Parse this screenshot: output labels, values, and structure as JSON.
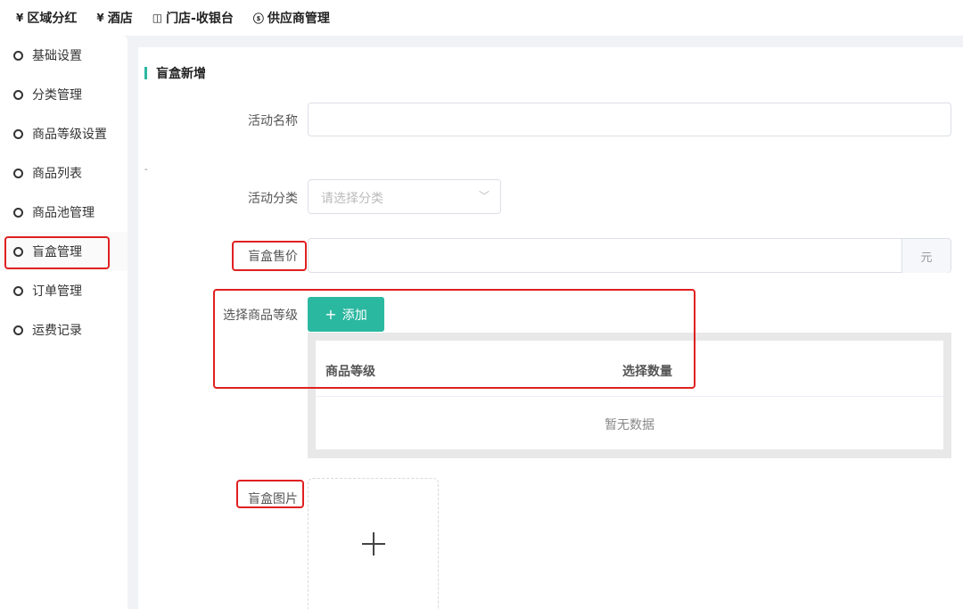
{
  "topnav": [
    {
      "icon": "¥",
      "icon_name": "dividend-icon",
      "label": "区域分红"
    },
    {
      "icon": "¥",
      "icon_name": "yen-icon",
      "label": "酒店"
    },
    {
      "icon": "◫",
      "icon_name": "cashier-icon",
      "label": "门店-收银台"
    },
    {
      "icon": "ⓢ",
      "icon_name": "supplier-icon",
      "label": "供应商管理"
    }
  ],
  "sidebar": {
    "items": [
      {
        "label": "基础设置"
      },
      {
        "label": "分类管理"
      },
      {
        "label": "商品等级设置"
      },
      {
        "label": "商品列表"
      },
      {
        "label": "商品池管理"
      },
      {
        "label": "盲盒管理"
      },
      {
        "label": "订单管理"
      },
      {
        "label": "运费记录"
      }
    ],
    "active_index": 5
  },
  "form": {
    "section_title": "盲盒新增",
    "stray_text": "-",
    "activity_name": {
      "label": "活动名称",
      "value": ""
    },
    "activity_category": {
      "label": "活动分类",
      "placeholder": "请选择分类"
    },
    "price": {
      "label": "盲盒售价",
      "value": "",
      "suffix": "元"
    },
    "grade": {
      "label": "选择商品等级",
      "add_button": "添加",
      "columns": [
        "商品等级",
        "选择数量"
      ],
      "empty_text": "暂无数据"
    },
    "image": {
      "label": "盲盒图片"
    }
  },
  "colors": {
    "accent": "#2bb8a0",
    "highlight": "#e02020"
  }
}
